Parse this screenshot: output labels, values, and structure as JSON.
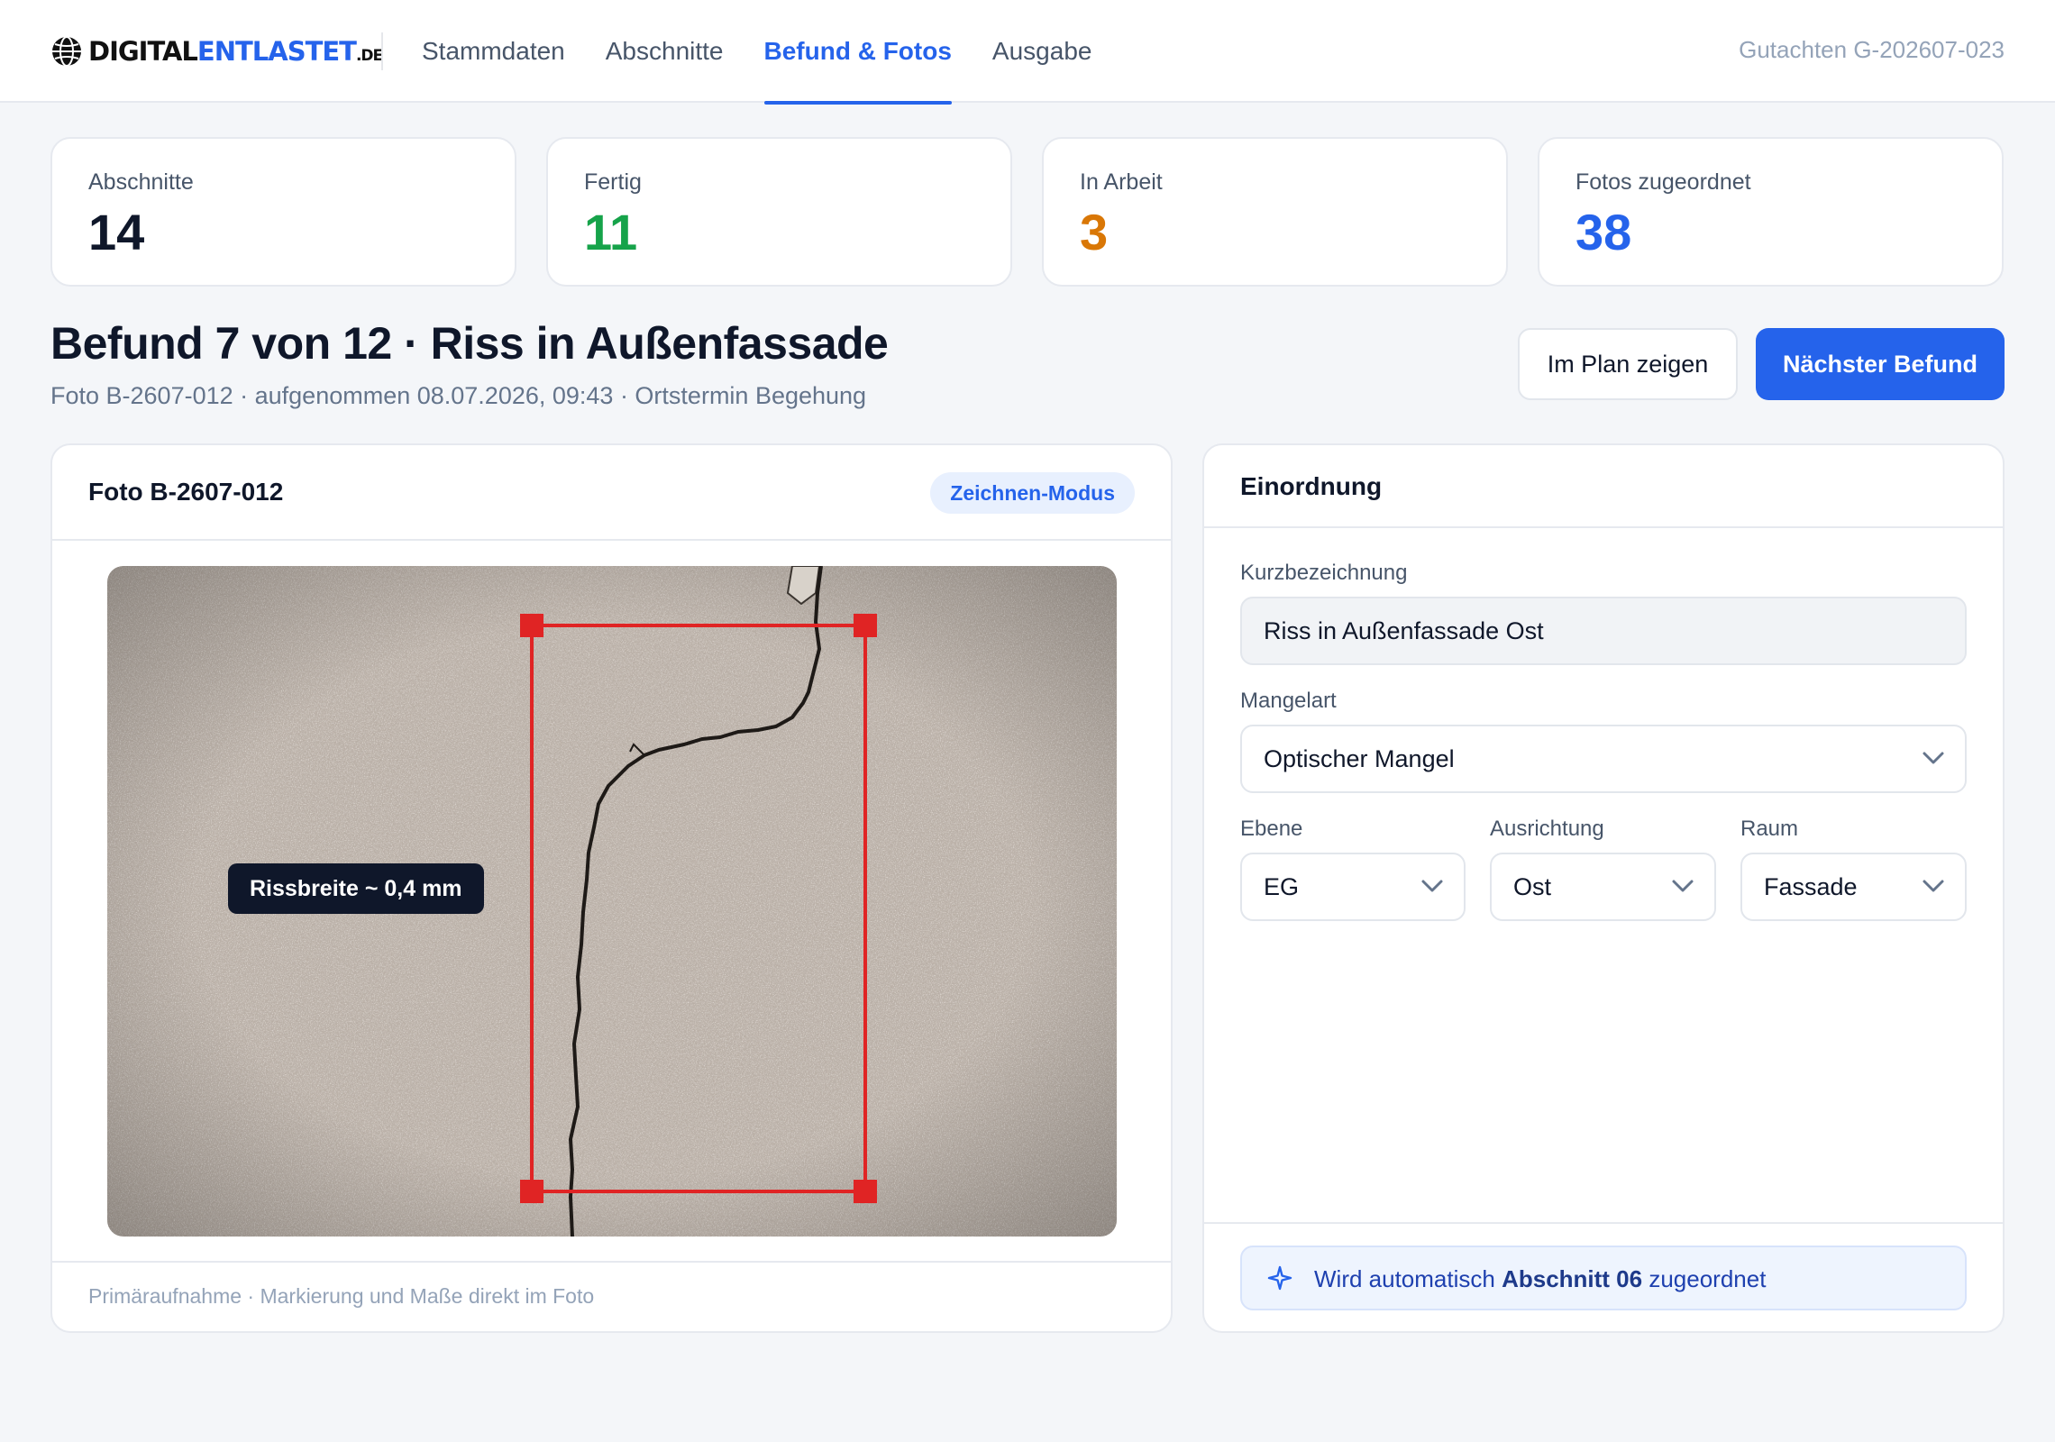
{
  "header": {
    "logo": {
      "part1": "DIGITAL",
      "part2": "ENTLASTET",
      "tld": ".DE"
    },
    "nav": [
      {
        "label": "Stammdaten"
      },
      {
        "label": "Abschnitte"
      },
      {
        "label": "Befund & Fotos"
      },
      {
        "label": "Ausgabe"
      }
    ],
    "active_nav": "Befund & Fotos",
    "case_id": "Gutachten G-202607-023"
  },
  "stats": [
    {
      "label": "Abschnitte",
      "value": "14",
      "color": "#0f172a"
    },
    {
      "label": "Fertig",
      "value": "11",
      "color": "#16a34a"
    },
    {
      "label": "In Arbeit",
      "value": "3",
      "color": "#d97706"
    },
    {
      "label": "Fotos zugeordnet",
      "value": "38",
      "color": "#2563eb"
    }
  ],
  "finding": {
    "title": "Befund 7 von 12 · Riss in Außenfassade",
    "subtitle": "Foto B-2607-012 · aufgenommen 08.07.2026, 09:43 · Ortstermin Begehung",
    "btn_plan": "Im Plan zeigen",
    "btn_next": "Nächster Befund"
  },
  "photo": {
    "title": "Foto B-2607-012",
    "mode": "Zeichnen-Modus",
    "measurement": "Rissbreite ~ 0,4 mm",
    "caption": "Primäraufnahme · Markierung und Maße direkt im Foto"
  },
  "classification": {
    "title": "Einordnung",
    "short_label": "Kurzbezeichnung",
    "short_value": "Riss in Außenfassade Ost",
    "defect_label": "Mangelart",
    "defect_value": "Optischer Mangel",
    "level_label": "Ebene",
    "level_value": "EG",
    "orient_label": "Ausrichtung",
    "orient_value": "Ost",
    "room_label": "Raum",
    "room_value": "Fassade",
    "auto_prefix": "Wird automatisch ",
    "auto_section": "Abschnitt 06",
    "auto_suffix": " zugeordnet"
  },
  "colors": {
    "accent": "#2563eb",
    "marker": "#e02424"
  },
  "icons": [
    "globe-icon",
    "chevron-down-icon",
    "sparkle-icon"
  ]
}
